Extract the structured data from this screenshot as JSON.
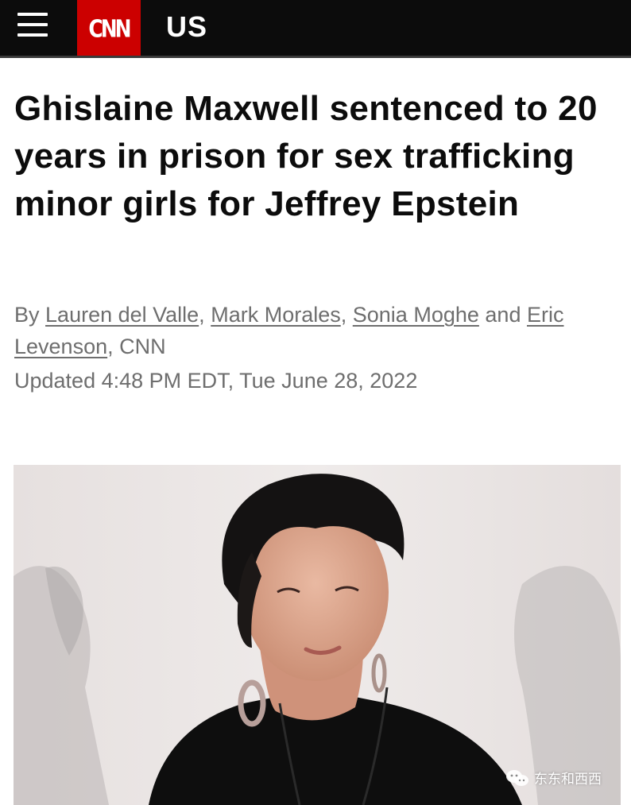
{
  "header": {
    "logo_text": "CNN",
    "section_label": "US",
    "bar_color": "#0c0c0c",
    "logo_color": "#cc0000"
  },
  "article": {
    "headline": "Ghislaine Maxwell sentenced to 20 years in prison for sex trafficking minor girls for Jeffrey Epstein",
    "byline": {
      "prefix": "By",
      "authors": [
        "Lauren del Valle",
        "Mark Morales",
        "Sonia Moghe",
        "Eric Levenson"
      ],
      "separator": ",",
      "conjunction": "and",
      "source_suffix": ", CNN"
    },
    "timestamp": "Updated 4:48 PM EDT, Tue June 28, 2022"
  },
  "photo": {
    "watermark_text": "东东和西西",
    "watermark_icon": "wechat-icon"
  }
}
